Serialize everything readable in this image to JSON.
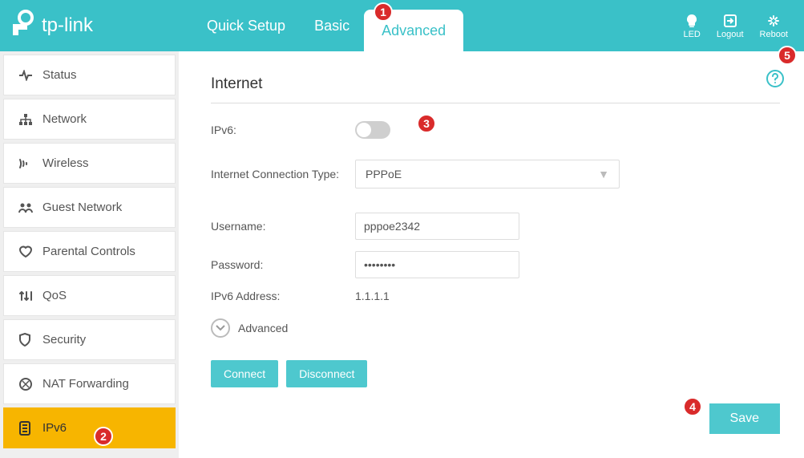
{
  "brand": "tp-link",
  "tabs": {
    "quick": "Quick Setup",
    "basic": "Basic",
    "advanced": "Advanced"
  },
  "header_actions": {
    "led": "LED",
    "logout": "Logout",
    "reboot": "Reboot"
  },
  "sidebar": {
    "status": "Status",
    "network": "Network",
    "wireless": "Wireless",
    "guest": "Guest Network",
    "parental": "Parental Controls",
    "qos": "QoS",
    "security": "Security",
    "nat": "NAT Forwarding",
    "ipv6": "IPv6"
  },
  "page": {
    "title": "Internet",
    "ipv6_label": "IPv6:",
    "conn_type_label": "Internet Connection Type:",
    "conn_type_value": "PPPoE",
    "username_label": "Username:",
    "username_value": "pppoe2342",
    "password_label": "Password:",
    "password_value": "••••••••",
    "ipv6_addr_label": "IPv6 Address:",
    "ipv6_addr_value": "1.1.1.1",
    "advanced_toggle": "Advanced",
    "connect": "Connect",
    "disconnect": "Disconnect",
    "save": "Save"
  },
  "callouts": {
    "c1": "1",
    "c2": "2",
    "c3": "3",
    "c4": "4",
    "c5": "5"
  }
}
